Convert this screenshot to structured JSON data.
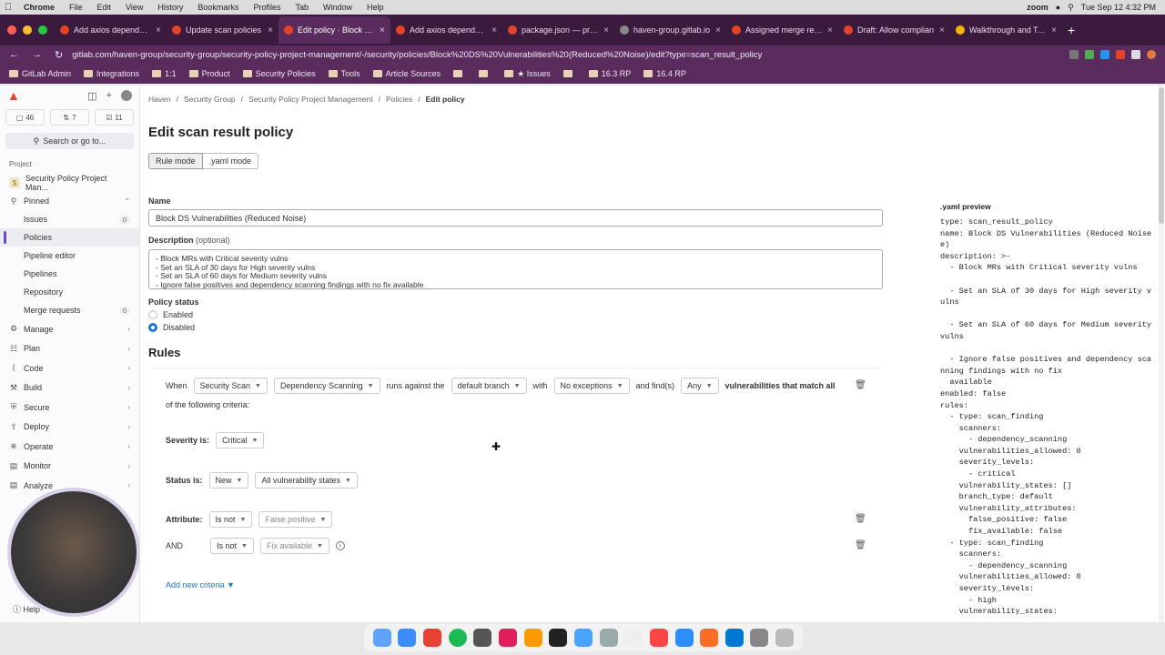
{
  "menubar": {
    "app": "Chrome",
    "items": [
      "File",
      "Edit",
      "View",
      "History",
      "Bookmarks",
      "Profiles",
      "Tab",
      "Window",
      "Help"
    ],
    "zoom_label": "zoom",
    "clock": "Tue Sep 12  4:32 PM"
  },
  "tabs": [
    {
      "title": "Add axios dependenc",
      "color": "#e24329"
    },
    {
      "title": "Update scan policies",
      "color": "#e24329"
    },
    {
      "title": "Edit policy · Block DS",
      "color": "#e24329",
      "active": true
    },
    {
      "title": "Add axios dependenc",
      "color": "#e24329"
    },
    {
      "title": "package.json — proje",
      "color": "#e24329"
    },
    {
      "title": "haven-group.gitlab.io",
      "color": "#888888"
    },
    {
      "title": "Assigned merge requ",
      "color": "#e24329"
    },
    {
      "title": "Draft: Allow complian",
      "color": "#e24329"
    },
    {
      "title": "Walkthrough and Test",
      "color": "#f5b400"
    }
  ],
  "address": {
    "url": "gitlab.com/haven-group/security-group/security-policy-project-management/-/security/policies/Block%20DS%20Vulnerabilities%20(Reduced%20Noise)/edit?type=scan_result_policy"
  },
  "bookmarks": [
    "GitLab Admin",
    "Integrations",
    "1:1",
    "Product",
    "Security Policies",
    "Tools",
    "Article Sources",
    "",
    "",
    "★ Issues",
    "",
    "16.3 RP",
    "16.4 RP"
  ],
  "sidebar": {
    "counts": [
      "46",
      "7",
      "11"
    ],
    "search": "Search or go to...",
    "section": "Project",
    "project": "Security Policy Project Man...",
    "project_initial": "S",
    "pinned": "Pinned",
    "pinned_items": [
      {
        "label": "Issues",
        "count": "0"
      },
      {
        "label": "Policies",
        "active": true
      },
      {
        "label": "Pipeline editor"
      },
      {
        "label": "Pipelines"
      },
      {
        "label": "Repository"
      },
      {
        "label": "Merge requests",
        "count": "0"
      }
    ],
    "groups": [
      "Manage",
      "Plan",
      "Code",
      "Build",
      "Secure",
      "Deploy",
      "Operate",
      "Monitor",
      "Analyze"
    ],
    "help": "Help"
  },
  "breadcrumbs": [
    "Haven",
    "Security Group",
    "Security Policy Project Management",
    "Policies",
    "Edit policy"
  ],
  "page": {
    "title": "Edit scan result policy",
    "mode_rule": "Rule mode",
    "mode_yaml": ".yaml mode",
    "name_label": "Name",
    "name_value": "Block DS Vulnerabilities (Reduced Noise)",
    "desc_label": "Description",
    "desc_opt": "(optional)",
    "desc_lines": [
      "- Block MRs with Critical severity vulns",
      "- Set an SLA of 30 days for High severity vulns",
      "- Set an SLA of 60 days for Medium severity vulns",
      "- Ignore false positives and dependency scanning findings with no fix available"
    ],
    "status_label": "Policy status",
    "enabled": "Enabled",
    "disabled": "Disabled",
    "rules_title": "Rules"
  },
  "rule": {
    "when": "When",
    "scan_type": "Security Scan",
    "scanner": "Dependency Scanning",
    "runs_against": "runs against the",
    "branch": "default branch",
    "with": "with",
    "exceptions": "No exceptions",
    "and_find": "and find(s)",
    "any": "Any",
    "vuln_match": "vulnerabilities that match all",
    "following": "of the following criteria:",
    "severity_label": "Severity is:",
    "severity": "Critical",
    "status_label": "Status is:",
    "status": "New",
    "states": "All vulnerability states",
    "attribute_label": "Attribute:",
    "attr_op": "Is not",
    "attr_value": "False positive",
    "and": "AND",
    "and_op": "Is not",
    "and_value": "Fix available",
    "add_criteria": "Add new criteria"
  },
  "yaml": {
    "title": ".yaml preview",
    "text": "type: scan_result_policy\nname: Block DS Vulnerabilities (Reduced Noise\ne)\ndescription: >-\n  - Block MRs with Critical severity vulns\n\n  - Set an SLA of 30 days for High severity v\nulns\n\n  - Set an SLA of 60 days for Medium severity\nvulns\n\n  - Ignore false positives and dependency sca\nnning findings with no fix\n  available\nenabled: false\nrules:\n  - type: scan_finding\n    scanners:\n      - dependency_scanning\n    vulnerabilities_allowed: 0\n    severity_levels:\n      - critical\n    vulnerability_states: []\n    branch_type: default\n    vulnerability_attributes:\n      false_positive: false\n      fix_available: false\n  - type: scan_finding\n    scanners:\n      - dependency_scanning\n    vulnerabilities_allowed: 0\n    severity_levels:\n      - high\n    vulnerability_states:"
  }
}
